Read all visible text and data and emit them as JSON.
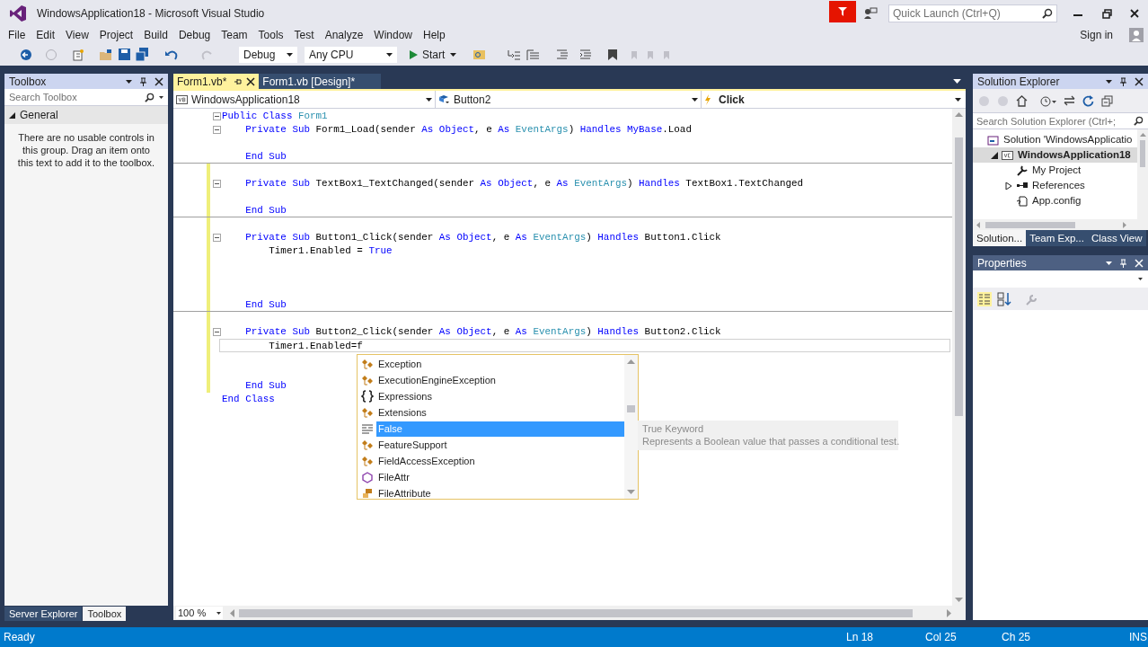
{
  "window": {
    "title": "WindowsApplication18 - Microsoft Visual Studio"
  },
  "quick_launch": {
    "placeholder": "Quick Launch (Ctrl+Q)"
  },
  "menu": [
    "File",
    "Edit",
    "View",
    "Project",
    "Build",
    "Debug",
    "Team",
    "Tools",
    "Test",
    "Analyze",
    "Window",
    "Help"
  ],
  "sign_in": "Sign in",
  "toolbar": {
    "configuration": "Debug",
    "platform": "Any CPU",
    "start": "Start"
  },
  "toolbox": {
    "title": "Toolbox",
    "search_placeholder": "Search Toolbox",
    "group": "General",
    "expanded": true,
    "message": "There are no usable controls in this group. Drag an item onto this text to add it to the toolbox.",
    "bottom_tabs": [
      {
        "label": "Server Explorer",
        "selected": false
      },
      {
        "label": "Toolbox",
        "selected": true
      }
    ]
  },
  "editor": {
    "tabs": [
      {
        "label": "Form1.vb*",
        "selected": true
      },
      {
        "label": "Form1.vb [Design]*",
        "selected": false
      }
    ],
    "project_dropdown": "WindowsApplication18",
    "object_dropdown": "Button2",
    "event_dropdown": "Click",
    "lines": [
      {
        "fold": true,
        "changed": false,
        "separator": false,
        "current": false,
        "segments": [
          {
            "text": "Public Class ",
            "kind": "keyword"
          },
          {
            "text": "Form1",
            "kind": "type"
          }
        ]
      },
      {
        "fold": true,
        "changed": false,
        "separator": false,
        "current": false,
        "segments": [
          {
            "text": "    Private Sub",
            "kind": "keyword"
          },
          {
            "text": " Form1_Load(sender ",
            "kind": "plain"
          },
          {
            "text": "As Object",
            "kind": "keyword"
          },
          {
            "text": ", e ",
            "kind": "plain"
          },
          {
            "text": "As ",
            "kind": "keyword"
          },
          {
            "text": "EventArgs",
            "kind": "type"
          },
          {
            "text": ") ",
            "kind": "plain"
          },
          {
            "text": "Handles MyBase",
            "kind": "keyword"
          },
          {
            "text": ".Load",
            "kind": "plain"
          }
        ]
      },
      {
        "fold": false,
        "changed": false,
        "separator": false,
        "current": false
      },
      {
        "fold": false,
        "changed": false,
        "separator": true,
        "current": false,
        "segments": [
          {
            "text": "    End Sub",
            "kind": "keyword"
          }
        ]
      },
      {
        "fold": false,
        "changed": true,
        "separator": false,
        "current": false
      },
      {
        "fold": true,
        "changed": true,
        "separator": false,
        "current": false,
        "segments": [
          {
            "text": "    Private Sub",
            "kind": "keyword"
          },
          {
            "text": " TextBox1_TextChanged(sender ",
            "kind": "plain"
          },
          {
            "text": "As Object",
            "kind": "keyword"
          },
          {
            "text": ", e ",
            "kind": "plain"
          },
          {
            "text": "As ",
            "kind": "keyword"
          },
          {
            "text": "EventArgs",
            "kind": "type"
          },
          {
            "text": ") ",
            "kind": "plain"
          },
          {
            "text": "Handles",
            "kind": "keyword"
          },
          {
            "text": " TextBox1.TextChanged",
            "kind": "plain"
          }
        ]
      },
      {
        "fold": false,
        "changed": true,
        "separator": false,
        "current": false
      },
      {
        "fold": false,
        "changed": true,
        "separator": true,
        "current": false,
        "segments": [
          {
            "text": "    End Sub",
            "kind": "keyword"
          }
        ]
      },
      {
        "fold": false,
        "changed": true,
        "separator": false,
        "current": false
      },
      {
        "fold": true,
        "changed": true,
        "separator": false,
        "current": false,
        "segments": [
          {
            "text": "    Private Sub",
            "kind": "keyword"
          },
          {
            "text": " Button1_Click(sender ",
            "kind": "plain"
          },
          {
            "text": "As Object",
            "kind": "keyword"
          },
          {
            "text": ", e ",
            "kind": "plain"
          },
          {
            "text": "As ",
            "kind": "keyword"
          },
          {
            "text": "EventArgs",
            "kind": "type"
          },
          {
            "text": ") ",
            "kind": "plain"
          },
          {
            "text": "Handles",
            "kind": "keyword"
          },
          {
            "text": " Button1.Click",
            "kind": "plain"
          }
        ]
      },
      {
        "fold": false,
        "changed": true,
        "separator": false,
        "current": false,
        "segments": [
          {
            "text": "        Timer1.Enabled = ",
            "kind": "plain"
          },
          {
            "text": "True",
            "kind": "keyword"
          }
        ]
      },
      {
        "fold": false,
        "changed": true,
        "separator": false,
        "current": false
      },
      {
        "fold": false,
        "changed": true,
        "separator": false,
        "current": false
      },
      {
        "fold": false,
        "changed": true,
        "separator": false,
        "current": false
      },
      {
        "fold": false,
        "changed": true,
        "separator": true,
        "current": false,
        "segments": [
          {
            "text": "    End Sub",
            "kind": "keyword"
          }
        ]
      },
      {
        "fold": false,
        "changed": true,
        "separator": false,
        "current": false
      },
      {
        "fold": true,
        "changed": true,
        "separator": false,
        "current": false,
        "segments": [
          {
            "text": "    Private Sub",
            "kind": "keyword"
          },
          {
            "text": " Button2_Click(sender ",
            "kind": "plain"
          },
          {
            "text": "As Object",
            "kind": "keyword"
          },
          {
            "text": ", e ",
            "kind": "plain"
          },
          {
            "text": "As ",
            "kind": "keyword"
          },
          {
            "text": "EventArgs",
            "kind": "type"
          },
          {
            "text": ") ",
            "kind": "plain"
          },
          {
            "text": "Handles",
            "kind": "keyword"
          },
          {
            "text": " Button2.Click",
            "kind": "plain"
          }
        ]
      },
      {
        "fold": false,
        "changed": true,
        "separator": false,
        "current": true,
        "segments": [
          {
            "text": "        Timer1.Enabled=f",
            "kind": "plain"
          }
        ]
      },
      {
        "fold": false,
        "changed": true,
        "separator": false,
        "current": false
      },
      {
        "fold": false,
        "changed": true,
        "separator": false,
        "current": false
      },
      {
        "fold": false,
        "changed": true,
        "separator": false,
        "current": false,
        "segments": [
          {
            "text": "    End Sub",
            "kind": "keyword"
          }
        ]
      },
      {
        "fold": false,
        "changed": false,
        "separator": false,
        "current": false,
        "segments": [
          {
            "text": "End Class",
            "kind": "keyword"
          }
        ]
      }
    ],
    "zoom": "100 %"
  },
  "completion": {
    "items": [
      {
        "label": "Exception",
        "kind": "class",
        "selected": false
      },
      {
        "label": "ExecutionEngineException",
        "kind": "class",
        "selected": false
      },
      {
        "label": "Expressions",
        "kind": "namespace",
        "selected": false
      },
      {
        "label": "Extensions",
        "kind": "class",
        "selected": false
      },
      {
        "label": "False",
        "kind": "keyword",
        "selected": true
      },
      {
        "label": "FeatureSupport",
        "kind": "class",
        "selected": false
      },
      {
        "label": "FieldAccessException",
        "kind": "class",
        "selected": false
      },
      {
        "label": "FileAttr",
        "kind": "structure",
        "selected": false
      },
      {
        "label": "FileAttribute",
        "kind": "enum",
        "selected": false
      }
    ],
    "tooltip": {
      "title": "True Keyword",
      "description": "Represents a Boolean value that passes a conditional test."
    }
  },
  "solution_explorer": {
    "title": "Solution Explorer",
    "search_placeholder": "Search Solution Explorer (Ctrl+;",
    "tree": [
      {
        "label": "Solution 'WindowsApplicatio",
        "kind": "solution",
        "selected": false,
        "children": [
          {
            "label": "WindowsApplication18",
            "kind": "project",
            "expanded": true,
            "selected": true,
            "children": [
              {
                "label": "My Project",
                "kind": "settings",
                "selected": false
              },
              {
                "label": "References",
                "kind": "references",
                "expanded": false,
                "selected": false
              },
              {
                "label": "App.config",
                "kind": "config",
                "selected": false
              }
            ]
          }
        ]
      }
    ],
    "tabs": [
      {
        "label": "Solution...",
        "selected": true
      },
      {
        "label": "Team Exp...",
        "selected": false
      },
      {
        "label": "Class View",
        "selected": false
      }
    ]
  },
  "properties": {
    "title": "Properties"
  },
  "status_bar": {
    "message": "Ready",
    "line": "Ln 18",
    "column": "Col 25",
    "char": "Ch 25",
    "mode": "INS"
  }
}
